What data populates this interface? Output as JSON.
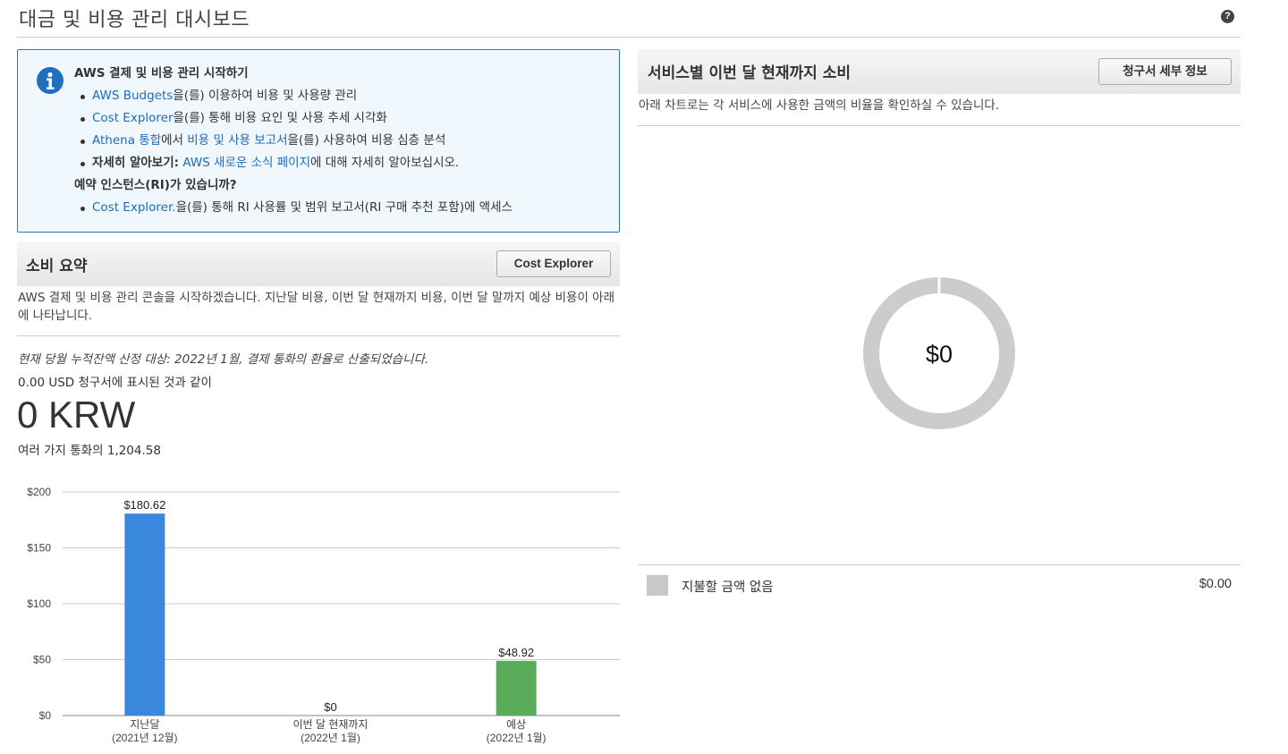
{
  "page": {
    "title": "대금 및 비용 관리 대시보드",
    "help_icon": "?"
  },
  "info": {
    "icon": "info-icon",
    "heading": "AWS 결제 및 비용 관리 시작하기",
    "items": [
      {
        "link": "AWS Budgets",
        "text": "을(를) 이용하여 비용 및 사용량 관리"
      },
      {
        "link": "Cost Explorer",
        "text": "을(를) 통해 비용 요인 및 사용 추세 시각화"
      },
      {
        "link": "Athena 통합",
        "mid": "에서 ",
        "link2": "비용 및 사용 보고서",
        "text": "을(를) 사용하여 비용 심층 분석"
      },
      {
        "bold": "자세히 알아보기:",
        "link": "AWS 새로운 소식 페이지",
        "text": "에 대해 자세히 알아보십시오."
      }
    ],
    "ri_heading": "예약 인스턴스(RI)가 있습니까?",
    "ri_item": {
      "link": "Cost Explorer.",
      "text": "을(를) 통해 RI 사용률 및 범위 보고서(RI 구매 추천 포함)에 액세스"
    }
  },
  "spend_summary": {
    "title": "소비 요약",
    "button_label": "Cost Explorer",
    "description": "AWS 결제 및 비용 관리 콘솔을 시작하겠습니다. 지난달 비용, 이번 달 현재까지 비용, 이번 달 말까지 예상 비용이 아래에 나타납니다.",
    "note": "현재 당월 누적잔액 산정 대상: 2022년 1월, 결제 통화의 환율로 산출되었습니다.",
    "usd_line": "0.00 USD 청구서에 표시된 것과 같이",
    "amount": "0 KRW",
    "rate_line": "여러 가지 통화의 1,204.58"
  },
  "by_service": {
    "title": "서비스별 이번 달 현재까지 소비",
    "button_label": "청구서 세부 정보",
    "description": "아래 차트로는 각 서비스에 사용한 금액의 비율을 확인하실 수 있습니다.",
    "donut_center": "$0",
    "legend_label": "지불할 금액 없음",
    "legend_value": "$0.00",
    "legend_color": "#c8c8c8"
  },
  "chart_data": [
    {
      "type": "bar",
      "categories": [
        [
          "지난달",
          "(2021년 12월)"
        ],
        [
          "이번 달 현재까지",
          "(2022년 1월)"
        ],
        [
          "예상",
          "(2022년 1월)"
        ]
      ],
      "values": [
        180.62,
        0,
        48.92
      ],
      "value_labels": [
        "$180.62",
        "$0",
        "$48.92"
      ],
      "colors": [
        "#3a88dd",
        "#3a88dd",
        "#5aab5a"
      ],
      "yticks": [
        "$0",
        "$50",
        "$100",
        "$150",
        "$200"
      ],
      "ylim": [
        0,
        200
      ],
      "grid": true
    },
    {
      "type": "pie",
      "labels": [
        "지불할 금액 없음"
      ],
      "values": [
        0
      ],
      "center_label": "$0",
      "colors": [
        "#cccccc"
      ]
    }
  ]
}
